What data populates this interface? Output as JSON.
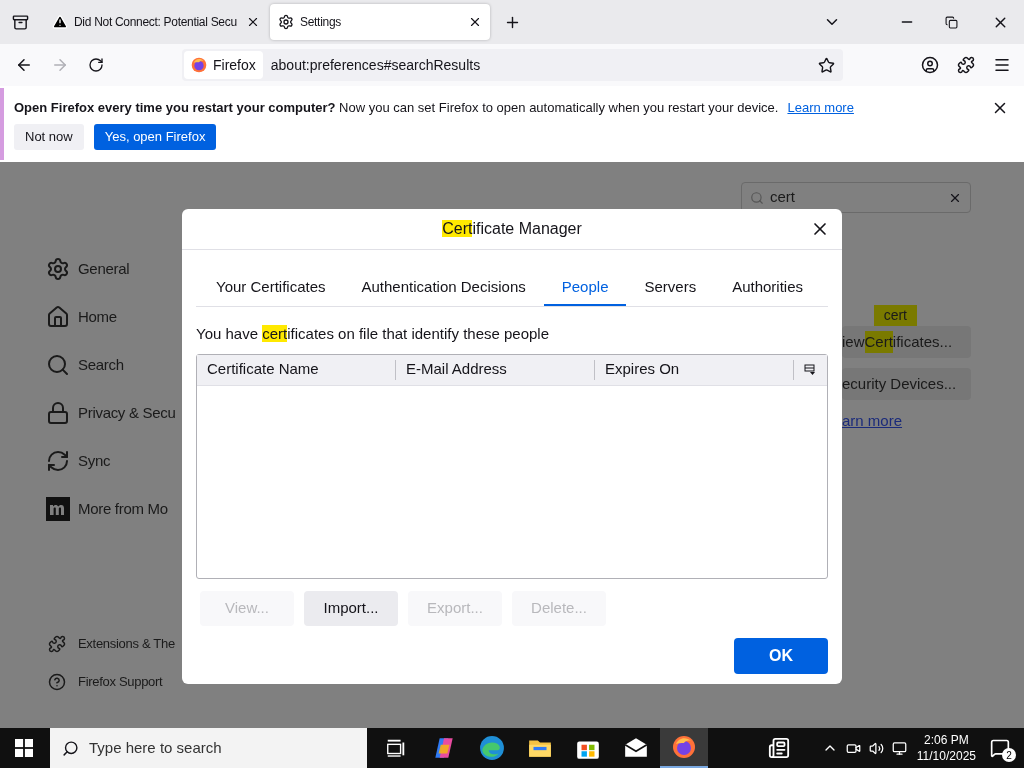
{
  "browser": {
    "tabs": [
      {
        "title": "Did Not Connect: Potential Secu",
        "selected": false
      },
      {
        "title": "Settings",
        "selected": true
      }
    ],
    "identity": "Firefox",
    "url": "about:preferences#searchResults"
  },
  "notification": {
    "message": "**Open Firefox every time you restart your computer?** Now you can set Firefox to open automatically when you restart your device.",
    "link": "Learn more",
    "buttons": [
      {
        "label": "Not now",
        "kind": "secondary"
      },
      {
        "label": "Yes, open Firefox",
        "kind": "primary"
      }
    ]
  },
  "sidebar": {
    "items": [
      {
        "label": "General"
      },
      {
        "label": "Home"
      },
      {
        "label": "Search"
      },
      {
        "label": "Privacy & Secu"
      },
      {
        "label": "Sync"
      },
      {
        "label": "More from Mo"
      }
    ],
    "footer": [
      {
        "label": "Extensions & The"
      },
      {
        "label": "Firefox Support"
      }
    ]
  },
  "search": {
    "value": "cert"
  },
  "results": {
    "tooltip": "cert",
    "buttons": [
      {
        "parts": [
          {
            "text": "iew ",
            "highlighted": false
          },
          {
            "text": "Cert",
            "highlighted": true
          },
          {
            "text": "ificates...",
            "highlighted": false
          }
        ]
      },
      {
        "parts": [
          {
            "text": "ecurity Devices...",
            "highlighted": false
          }
        ]
      }
    ],
    "link": "arn more"
  },
  "dialog": {
    "title": [
      {
        "text": "Cert",
        "highlighted": true
      },
      {
        "text": "ificate Manager",
        "highlighted": false
      }
    ],
    "tabs": [
      {
        "label": "Your Certificates",
        "selected": false
      },
      {
        "label": "Authentication Decisions",
        "selected": false
      },
      {
        "label": "People",
        "selected": true
      },
      {
        "label": "Servers",
        "selected": false
      },
      {
        "label": "Authorities",
        "selected": false
      }
    ],
    "description": [
      {
        "text": "You have ",
        "highlighted": false
      },
      {
        "text": "cert",
        "highlighted": true
      },
      {
        "text": "ificates on file that identify these people",
        "highlighted": false
      }
    ],
    "columns": [
      "Certificate Name",
      "E-Mail Address",
      "Expires On"
    ],
    "actions": [
      {
        "label": "View...",
        "disabled": true
      },
      {
        "label": "Import...",
        "disabled": false
      },
      {
        "label": "Export...",
        "disabled": true
      },
      {
        "label": "Delete...",
        "disabled": true
      }
    ],
    "ok": "OK"
  },
  "taskbar": {
    "search_placeholder": "Type here to search",
    "apps": [
      {
        "kind": "taskview",
        "active": false
      },
      {
        "kind": "copilot",
        "active": false
      },
      {
        "kind": "edge",
        "active": false
      },
      {
        "kind": "folder",
        "active": false
      },
      {
        "kind": "store",
        "active": false
      },
      {
        "kind": "mail",
        "active": false
      },
      {
        "kind": "firefox",
        "active": true
      }
    ],
    "time": "2:06 PM",
    "date": "11/10/2025",
    "notifications": "2"
  }
}
